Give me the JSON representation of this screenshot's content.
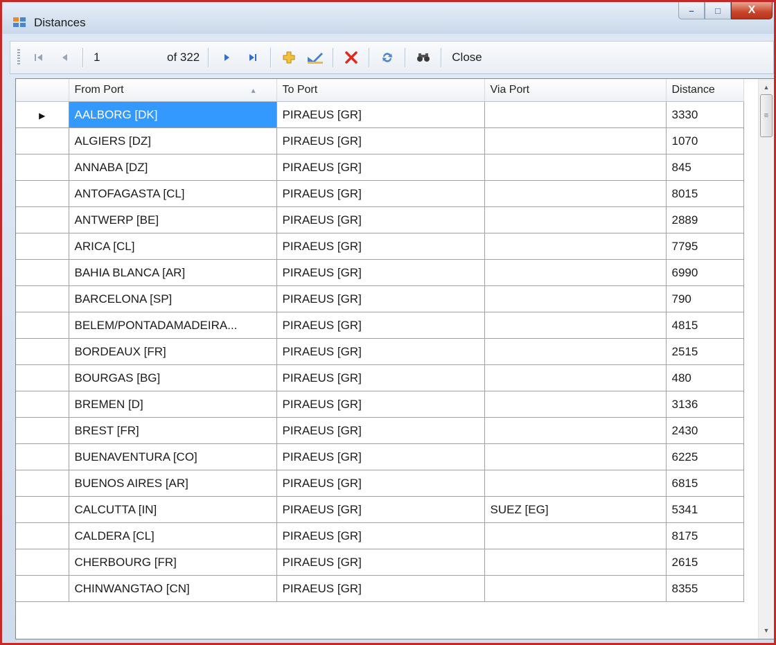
{
  "window": {
    "title": "Distances",
    "min_label": "–",
    "max_label": "□",
    "close_label": "X"
  },
  "toolbar": {
    "position_value": "1",
    "of_label": "of 322",
    "close_label": "Close",
    "icons": [
      "move-first-icon",
      "move-previous-icon",
      "move-next-icon",
      "move-last-icon",
      "add-new-icon",
      "edit-icon",
      "delete-icon",
      "refresh-icon",
      "find-icon"
    ]
  },
  "grid": {
    "columns": [
      "From Port",
      "To Port",
      "Via Port",
      "Distance"
    ],
    "sorted_column": "From Port",
    "sort_direction": "ascending",
    "selected_row": 0,
    "rows": [
      {
        "from": "AALBORG [DK]",
        "to": "PIRAEUS [GR]",
        "via": "",
        "distance": "3330"
      },
      {
        "from": "ALGIERS [DZ]",
        "to": "PIRAEUS [GR]",
        "via": "",
        "distance": "1070"
      },
      {
        "from": "ANNABA [DZ]",
        "to": "PIRAEUS [GR]",
        "via": "",
        "distance": "845"
      },
      {
        "from": "ANTOFAGASTA [CL]",
        "to": "PIRAEUS [GR]",
        "via": "",
        "distance": "8015"
      },
      {
        "from": "ANTWERP [BE]",
        "to": "PIRAEUS [GR]",
        "via": "",
        "distance": "2889"
      },
      {
        "from": "ARICA [CL]",
        "to": "PIRAEUS [GR]",
        "via": "",
        "distance": "7795"
      },
      {
        "from": "BAHIA BLANCA [AR]",
        "to": "PIRAEUS [GR]",
        "via": "",
        "distance": "6990"
      },
      {
        "from": "BARCELONA [SP]",
        "to": "PIRAEUS [GR]",
        "via": "",
        "distance": "790"
      },
      {
        "from": "BELEM/PONTADAMADEIRA...",
        "to": "PIRAEUS [GR]",
        "via": "",
        "distance": "4815"
      },
      {
        "from": "BORDEAUX [FR]",
        "to": "PIRAEUS [GR]",
        "via": "",
        "distance": "2515"
      },
      {
        "from": "BOURGAS [BG]",
        "to": "PIRAEUS [GR]",
        "via": "",
        "distance": "480"
      },
      {
        "from": "BREMEN [D]",
        "to": "PIRAEUS [GR]",
        "via": "",
        "distance": "3136"
      },
      {
        "from": "BREST [FR]",
        "to": "PIRAEUS [GR]",
        "via": "",
        "distance": "2430"
      },
      {
        "from": "BUENAVENTURA [CO]",
        "to": "PIRAEUS [GR]",
        "via": "",
        "distance": "6225"
      },
      {
        "from": "BUENOS AIRES [AR]",
        "to": "PIRAEUS [GR]",
        "via": "",
        "distance": "6815"
      },
      {
        "from": "CALCUTTA [IN]",
        "to": "PIRAEUS [GR]",
        "via": "SUEZ [EG]",
        "distance": "5341"
      },
      {
        "from": "CALDERA [CL]",
        "to": "PIRAEUS [GR]",
        "via": "",
        "distance": "8175"
      },
      {
        "from": "CHERBOURG [FR]",
        "to": "PIRAEUS [GR]",
        "via": "",
        "distance": "2615"
      },
      {
        "from": "CHINWANGTAO [CN]",
        "to": "PIRAEUS [GR]",
        "via": "",
        "distance": "8355"
      }
    ]
  },
  "colors": {
    "selection": "#3399ff",
    "window_border": "#c62828",
    "close_button": "#c9442a"
  }
}
